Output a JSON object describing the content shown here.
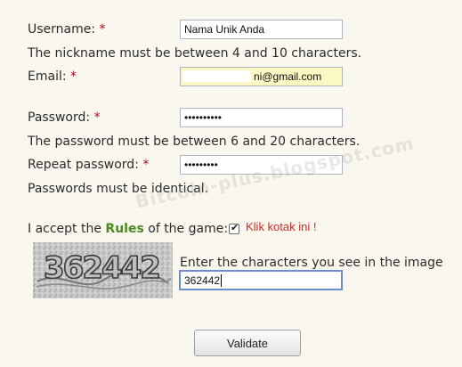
{
  "form": {
    "username_label": "Username:",
    "username_value": "Nama Unik Anda",
    "username_hint": "The nickname must be between 4 and 10 characters.",
    "email_label": "Email:",
    "email_value": "ni@gmail.com",
    "password_label": "Password:",
    "password_value": "••••••••••",
    "password_hint": "The password must be between 6 and 20 characters.",
    "repeat_label": "Repeat password:",
    "repeat_value": "•••••••••",
    "repeat_hint": "Passwords must be identical.",
    "required_mark": "*",
    "accept_prefix": "I accept the",
    "accept_rules_link": "Rules",
    "accept_suffix": "of the game:",
    "accept_checked": true,
    "annotation": "Klik kotak ini !",
    "captcha_image_text": "362442",
    "captcha_prompt": "Enter the characters you see in the image",
    "captcha_value": "362442",
    "validate_button": "Validate"
  },
  "watermark": "Bitcoin-plus.blogspot.com",
  "colors": {
    "required": "#c0001b",
    "rules_link": "#4c8a22",
    "annotation": "#d42727",
    "email_bg": "#fbf8c3",
    "captcha_border": "#6b8ccf"
  }
}
